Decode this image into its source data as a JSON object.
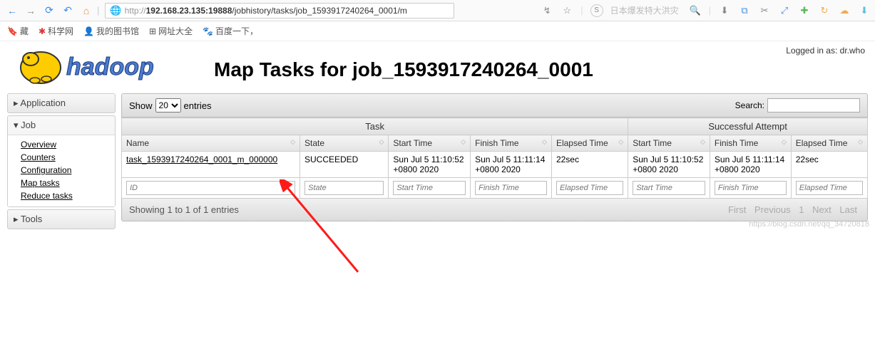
{
  "browser": {
    "url_prefix": "http://",
    "url_host": "192.168.23.135:19888",
    "url_path": "/jobhistory/tasks/job_1593917240264_0001/m",
    "search_ph": "日本爆发特大洪灾",
    "bookmarks": [
      {
        "icon": "🔖",
        "label": "藏"
      },
      {
        "icon": "🔴",
        "label": "科学网"
      },
      {
        "icon": "👤",
        "label": "我的图书馆"
      },
      {
        "icon": "🌐",
        "label": "网址大全"
      },
      {
        "icon": "🐾",
        "label": "百度一下，"
      }
    ]
  },
  "login_label": "Logged in as: ",
  "login_user": "dr.who",
  "page_title": "Map Tasks for job_1593917240264_0001",
  "sidebar": {
    "sections": [
      {
        "label": "Application",
        "expanded": false
      },
      {
        "label": "Job",
        "expanded": true,
        "links": [
          "Overview",
          "Counters",
          "Configuration",
          "Map tasks",
          "Reduce tasks"
        ]
      },
      {
        "label": "Tools",
        "expanded": false
      }
    ]
  },
  "dt": {
    "show": "Show",
    "entries": "entries",
    "per_page": "20",
    "search": "Search:",
    "group1": "Task",
    "group2": "Successful Attempt",
    "cols": [
      "Name",
      "State",
      "Start Time",
      "Finish Time",
      "Elapsed Time",
      "Start Time",
      "Finish Time",
      "Elapsed Time"
    ],
    "filter_ph": [
      "ID",
      "State",
      "Start Time",
      "Finish Time",
      "Elapsed Time",
      "Start Time",
      "Finish Time",
      "Elapsed Time"
    ],
    "row": {
      "name": "task_1593917240264_0001_m_000000",
      "state": "SUCCEEDED",
      "start1": "Sun Jul 5 11:10:52 +0800 2020",
      "finish1": "Sun Jul 5 11:11:14 +0800 2020",
      "elapsed1": "22sec",
      "start2": "Sun Jul 5 11:10:52 +0800 2020",
      "finish2": "Sun Jul 5 11:11:14 +0800 2020",
      "elapsed2": "22sec"
    },
    "info": "Showing 1 to 1 of 1 entries",
    "pager": [
      "First",
      "Previous",
      "1",
      "Next",
      "Last"
    ]
  },
  "watermark": "https://blog.csdn.net/qq_34720818"
}
